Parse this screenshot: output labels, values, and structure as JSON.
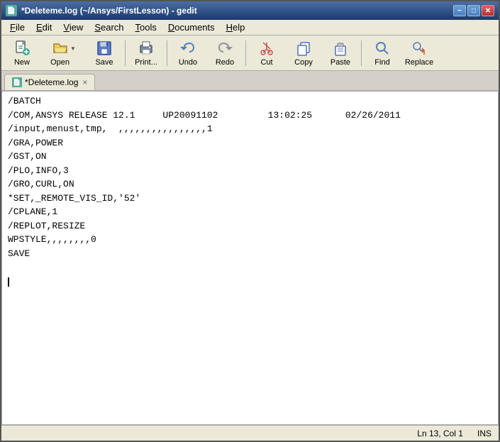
{
  "window": {
    "title": "*Deleteme.log (~/Ansys/FirstLesson) - gedit",
    "icon": "📄"
  },
  "titlebar": {
    "title": "*Deleteme.log (~/Ansys/FirstLesson) - gedit",
    "controls": {
      "minimize": "−",
      "maximize": "□",
      "close": "✕"
    }
  },
  "menubar": {
    "items": [
      {
        "label": "File",
        "underline_index": 0
      },
      {
        "label": "Edit",
        "underline_index": 0
      },
      {
        "label": "View",
        "underline_index": 0
      },
      {
        "label": "Search",
        "underline_index": 0
      },
      {
        "label": "Tools",
        "underline_index": 0
      },
      {
        "label": "Documents",
        "underline_index": 0
      },
      {
        "label": "Help",
        "underline_index": 0
      }
    ]
  },
  "toolbar": {
    "buttons": [
      {
        "id": "new",
        "label": "New",
        "icon": "new"
      },
      {
        "id": "open",
        "label": "Open",
        "icon": "open",
        "has_dropdown": true
      },
      {
        "id": "save",
        "label": "Save",
        "icon": "save"
      },
      {
        "separator": true
      },
      {
        "id": "print",
        "label": "Print...",
        "icon": "print"
      },
      {
        "separator": true
      },
      {
        "id": "undo",
        "label": "Undo",
        "icon": "undo"
      },
      {
        "id": "redo",
        "label": "Redo",
        "icon": "redo"
      },
      {
        "separator": true
      },
      {
        "id": "cut",
        "label": "Cut",
        "icon": "cut"
      },
      {
        "id": "copy",
        "label": "Copy",
        "icon": "copy"
      },
      {
        "id": "paste",
        "label": "Paste",
        "icon": "paste"
      },
      {
        "separator": true
      },
      {
        "id": "find",
        "label": "Find",
        "icon": "find"
      },
      {
        "id": "replace",
        "label": "Replace",
        "icon": "replace"
      }
    ]
  },
  "tab": {
    "filename": "*Deleteme.log",
    "close_label": "×"
  },
  "editor": {
    "lines": [
      "/BATCH",
      "/COM,ANSYS RELEASE 12.1     UP20091102         13:02:25      02/26/2011",
      "/input,menust,tmp,  ,,,,,,,,,,,,,,,,1",
      "/GRA,POWER",
      "/GST,ON",
      "/PLO,INFO,3",
      "/GRO,CURL,ON",
      "*SET,_REMOTE_VIS_ID,'52'",
      "/CPLANE,1",
      "/REPLOT,RESIZE",
      "WPSTYLE,,,,,,,,0",
      "SAVE",
      ""
    ],
    "cursor_line": 13
  },
  "statusbar": {
    "position": "Ln 13, Col 1",
    "mode": "INS"
  }
}
